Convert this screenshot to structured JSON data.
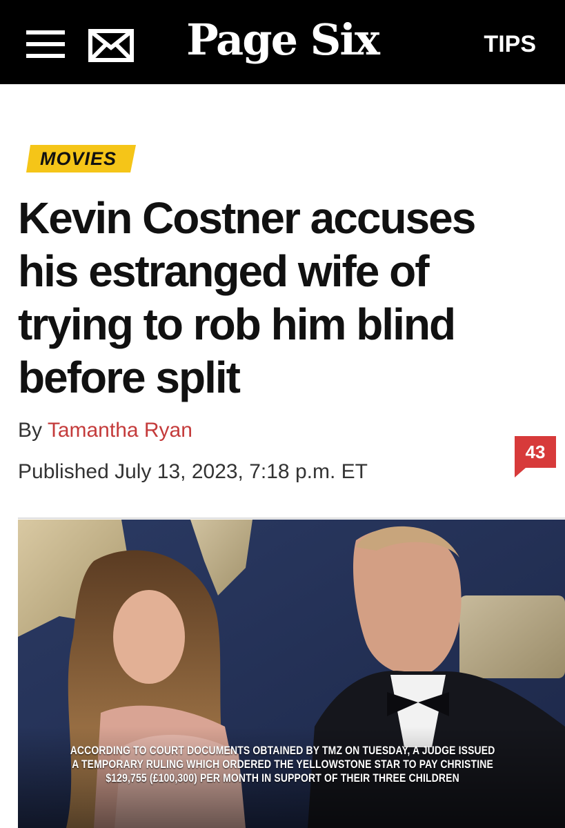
{
  "header": {
    "logo": "Page Six",
    "tips_label": "TIPS",
    "menu_icon": "hamburger-menu-icon",
    "mail_icon": "envelope-icon",
    "background": "#000000"
  },
  "article": {
    "category": "MOVIES",
    "category_color": "#f5c518",
    "headline": "Kevin Costner accuses his estranged wife of trying to rob him blind before split",
    "byline_prefix": "By",
    "author": "Tamantha Ryan",
    "author_color": "#c43b3b",
    "published": "Published July 13, 2023, 7:18 p.m. ET",
    "comment_count": "43",
    "comment_color": "#d73a3a"
  },
  "photo": {
    "caption": "According to court documents obtained by TMZ on Tuesday, a judge issued a temporary ruling which ordered the Yellowstone star to pay Christine $129,755 (£100,300) per month in support of their three children",
    "caption_lines": [
      "According to court documents obtained by TMZ on Tuesday, a judge issued",
      "a temporary ruling which ordered the Yellowstone star to pay Christine",
      "$129,755 (£100,300) per month in support of their three children"
    ]
  }
}
